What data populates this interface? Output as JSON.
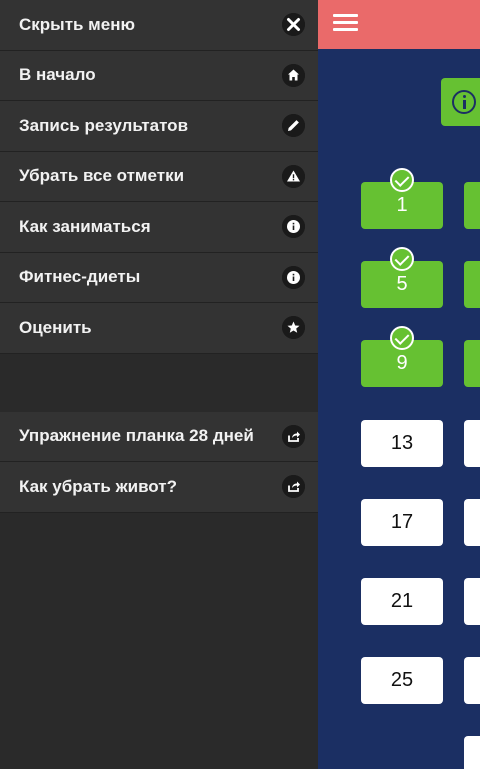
{
  "drawer": {
    "items": [
      {
        "label": "Скрыть меню",
        "icon": "close-icon"
      },
      {
        "label": "В начало",
        "icon": "home-icon"
      },
      {
        "label": "Запись результатов",
        "icon": "pencil-icon"
      },
      {
        "label": "Убрать все отметки",
        "icon": "warning-icon"
      },
      {
        "label": "Как заниматься",
        "icon": "info-icon"
      },
      {
        "label": "Фитнес-диеты",
        "icon": "info-icon"
      },
      {
        "label": "Оценить",
        "icon": "star-icon"
      }
    ],
    "links": [
      {
        "label": "Упражнение планка 28 дней",
        "icon": "share-icon"
      },
      {
        "label": "Как убрать живот?",
        "icon": "share-icon"
      }
    ]
  },
  "main": {
    "days_col1": [
      {
        "label": "1",
        "done": true
      },
      {
        "label": "5",
        "done": true
      },
      {
        "label": "9",
        "done": true
      },
      {
        "label": "13",
        "done": false
      },
      {
        "label": "17",
        "done": false
      },
      {
        "label": "21",
        "done": false
      },
      {
        "label": "25",
        "done": false
      }
    ]
  },
  "colors": {
    "topbar": "#ea6a6a",
    "background": "#1b2f63",
    "done": "#66c132",
    "drawer": "#333333"
  }
}
